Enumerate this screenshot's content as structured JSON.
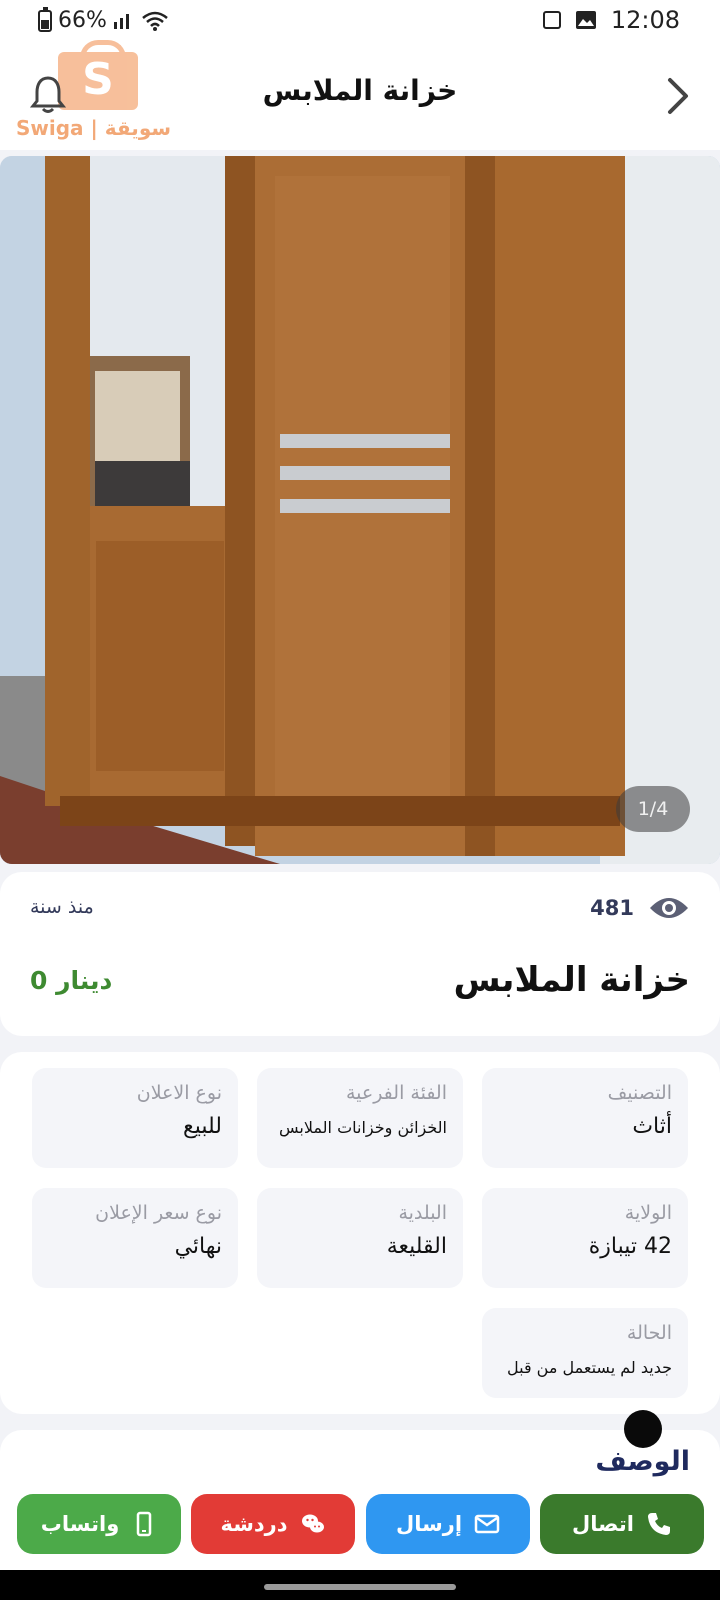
{
  "status_bar": {
    "battery": "66%",
    "time": "12:08"
  },
  "header": {
    "title": "خزانة الملابس",
    "logo_text": "Swiga | سويقة"
  },
  "gallery": {
    "pager": "1/4"
  },
  "summary": {
    "views": "481",
    "posted": "منذ سنة",
    "title": "خزانة الملابس",
    "price": "0 دينار",
    "price_color": "#3e8a31"
  },
  "details": [
    {
      "label": "التصنيف",
      "value": "أثاث"
    },
    {
      "label": "الفئة الفرعية",
      "value": "الخزائن وخزانات الملابس"
    },
    {
      "label": "نوع الاعلان",
      "value": "للبيع"
    },
    {
      "label": "الولاية",
      "value": "42 تيبازة"
    },
    {
      "label": "البلدية",
      "value": "القليعة"
    },
    {
      "label": "نوع سعر الإعلان",
      "value": "نهائي"
    },
    {
      "label": "الحالة",
      "value": "جديد لم يستعمل من قبل"
    }
  ],
  "description": {
    "title": "الوصف"
  },
  "actions": {
    "call": "اتصال",
    "send": "إرسال",
    "chat": "دردشة",
    "whatsapp": "واتساب",
    "colors": {
      "call": "#3a7a2c",
      "send": "#2f97f1",
      "chat": "#e23b36",
      "whatsapp": "#4caa49"
    }
  },
  "icons": [
    "bell-icon",
    "chevron-right-icon",
    "eye-icon",
    "phone-icon",
    "mail-icon",
    "chat-icon",
    "mobile-icon"
  ]
}
